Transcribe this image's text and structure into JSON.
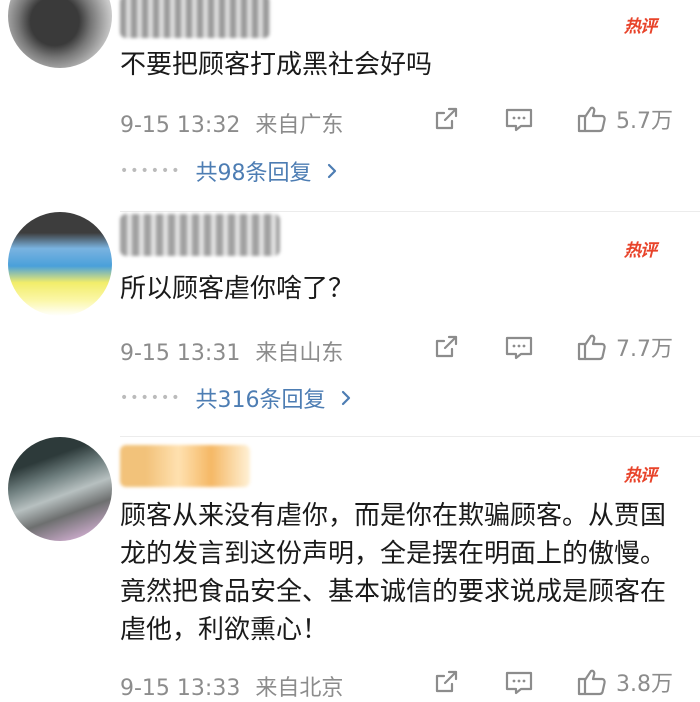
{
  "comments": [
    {
      "text": "不要把顾客打成黑社会好吗",
      "date": "9-15 13:32",
      "location": "来自广东",
      "likes": "5.7万",
      "replies": "共98条回复",
      "hot_badge": "热评",
      "has_replies": true
    },
    {
      "text": "所以顾客虐你啥了？",
      "date": "9-15 13:31",
      "location": "来自山东",
      "likes": "7.7万",
      "replies": "共316条回复",
      "hot_badge": "热评",
      "has_replies": true
    },
    {
      "text": "顾客从来没有虐你，而是你在欺骗顾客。从贾国龙的发言到这份声明，全是摆在明面上的傲慢。竟然把食品安全、基本诚信的要求说成是顾客在虐他，利欲熏心！",
      "date": "9-15 13:33",
      "location": "来自北京",
      "likes": "3.8万",
      "hot_badge": "热评",
      "has_replies": false
    }
  ],
  "colors": {
    "hot_badge": "#e8432a",
    "reply_link": "#4d7db3",
    "meta_text": "#8c8c8c"
  }
}
